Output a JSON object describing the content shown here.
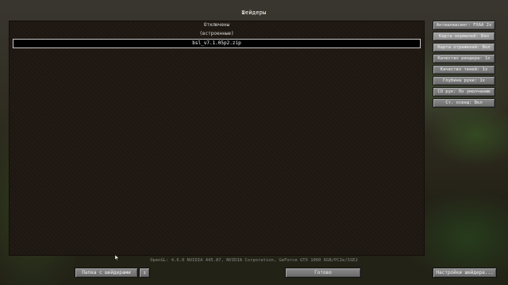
{
  "title": "Шейдеры",
  "shaders": [
    {
      "label": "Отключены",
      "selected": false
    },
    {
      "label": "(встроенные)",
      "selected": false
    },
    {
      "label": "bsl_v7.1.05p2.zip",
      "selected": true
    }
  ],
  "options": [
    "Антиалиасинг: FXAA 2x",
    "Карта нормалей: Вкл",
    "Карта отражений: Вкл",
    "Качество рендера: 1x",
    "Качество теней: 1x",
    "Глубина руки: 1x",
    "СО рук: По умолчанию",
    "Ст. освещ: Вкл"
  ],
  "info_line": "OpenGL: 4.6.0 NVIDIA 445.87, NVIDIA Corporation, GeForce GTX 1060 6GB/PCIe/SSE2",
  "buttons": {
    "open_folder": "Папка с шейдерами",
    "folder_icon": "↥",
    "done": "Готово",
    "settings": "Настройки шейдера..."
  },
  "colors": {
    "panel_bg": "#1e1711",
    "button_bg": "#7a7a7a",
    "selected_border": "#c8c8c8"
  }
}
